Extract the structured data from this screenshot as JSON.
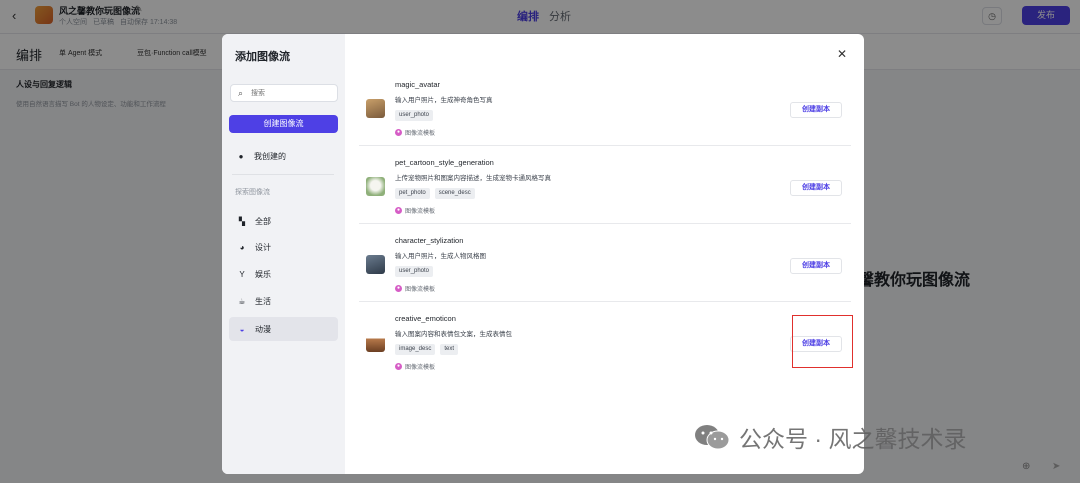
{
  "header": {
    "bot_name": "风之馨教你玩图像流",
    "meta": [
      "个人空间",
      "已草稿",
      "自动保存 17:14:38"
    ],
    "tabs": [
      "编排",
      "分析"
    ],
    "publish_label": "发布"
  },
  "subbar": {
    "title": "编排",
    "mode": "单 Agent 模式",
    "model": "豆包·Function call模型"
  },
  "background": {
    "persona_title": "人设与回复逻辑",
    "persona_desc": "使用自然语言描写 Bot 的人物设定、功能和工作流程",
    "right_title": "馨教你玩图像流"
  },
  "modal": {
    "title": "添加图像流",
    "search_placeholder": "搜索",
    "create_label": "创建图像流",
    "my_created": "我创建的",
    "explore_label": "探索图像流",
    "categories": [
      {
        "label": "全部",
        "icon": "grid-icon",
        "active": false
      },
      {
        "label": "设计",
        "icon": "palette-icon",
        "active": false
      },
      {
        "label": "娱乐",
        "icon": "trophy-icon",
        "active": false
      },
      {
        "label": "生活",
        "icon": "cup-icon",
        "active": false
      },
      {
        "label": "动漫",
        "icon": "anime-icon",
        "active": true
      }
    ],
    "flows": [
      {
        "name": "magic_avatar",
        "desc": "输入用户照片，生成神奇角色写真",
        "tags": [
          "user_photo"
        ],
        "source": "图像流模板",
        "action": "创建副本"
      },
      {
        "name": "pet_cartoon_style_generation",
        "desc": "上传宠物照片和图案内容描述，生成宠物卡通风格写真",
        "tags": [
          "pet_photo",
          "scene_desc"
        ],
        "source": "图像流模板",
        "action": "创建副本"
      },
      {
        "name": "character_stylization",
        "desc": "输入用户照片，生成人物风格图",
        "tags": [
          "user_photo"
        ],
        "source": "图像流模板",
        "action": "创建副本"
      },
      {
        "name": "creative_emoticon",
        "desc": "输入图案内容和表情包文案，生成表情包",
        "tags": [
          "image_desc",
          "text"
        ],
        "source": "图像流模板",
        "action": "创建副本"
      }
    ]
  },
  "watermark": "公众号 · 风之馨技术录",
  "colors": {
    "accent": "#4e40e5",
    "highlight": "#e0302d"
  }
}
